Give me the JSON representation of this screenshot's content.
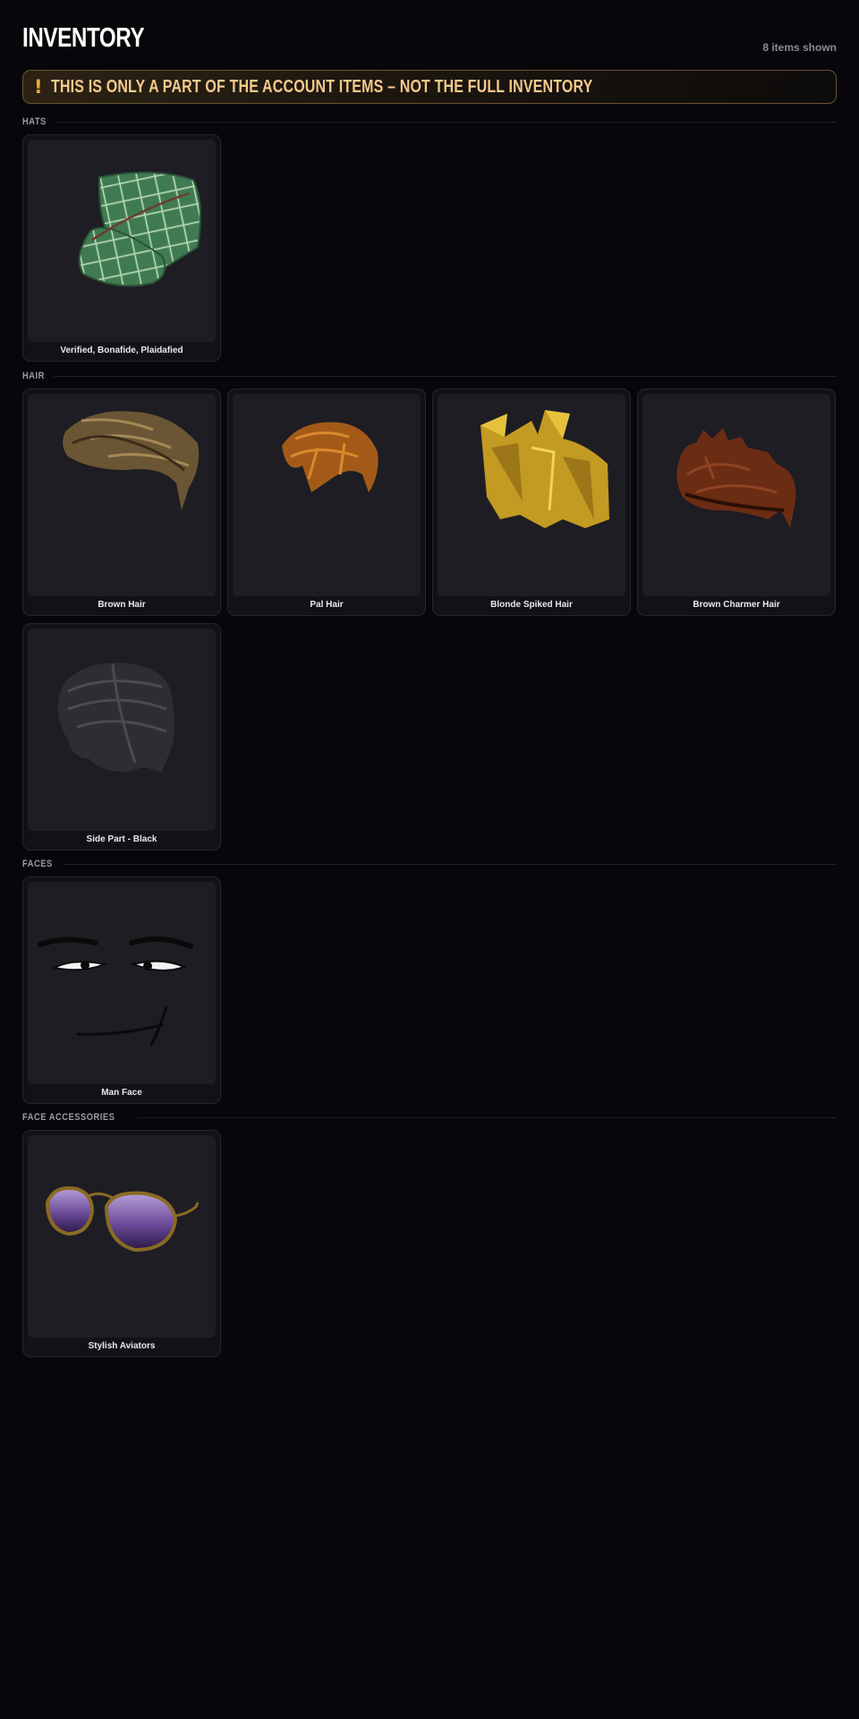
{
  "page": {
    "title": "INVENTORY",
    "items_count": "8 items shown"
  },
  "warning": {
    "icon": "exclamation-icon",
    "text": "THIS IS ONLY A PART OF THE ACCOUNT ITEMS – NOT THE FULL INVENTORY"
  },
  "colors": {
    "background": "#07070b",
    "warning_border": "#6a5330",
    "warning_text": "#f4c98a",
    "card_bg": "#111117",
    "thumb_bg": "#1d1d23"
  },
  "sections": [
    {
      "label": "HATS",
      "items": [
        {
          "name": "Verified, Bonafide, Plaidafied",
          "icon": "plaid-cap"
        }
      ]
    },
    {
      "label": "HAIR",
      "items": [
        {
          "name": "Brown Hair",
          "icon": "brown-hair"
        },
        {
          "name": "Pal Hair",
          "icon": "pal-hair"
        },
        {
          "name": "Blonde Spiked Hair",
          "icon": "blonde-spiked-hair"
        },
        {
          "name": "Brown Charmer Hair",
          "icon": "brown-charmer-hair"
        },
        {
          "name": "Side Part - Black",
          "icon": "side-part-black-hair"
        }
      ]
    },
    {
      "label": "FACES",
      "items": [
        {
          "name": "Man Face",
          "icon": "man-face"
        }
      ]
    },
    {
      "label": "FACE ACCESSORIES",
      "items": [
        {
          "name": "Stylish Aviators",
          "icon": "aviator-sunglasses"
        }
      ]
    }
  ]
}
